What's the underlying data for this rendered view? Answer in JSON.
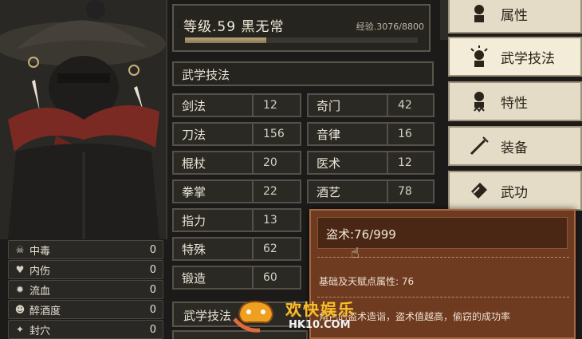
{
  "character": {
    "level_title": "等级.59 黑无常",
    "exp_text": "经验.3076/8800",
    "exp_progress": 0.35
  },
  "section": {
    "title": "武学技法"
  },
  "stats": [
    {
      "name": "剑法",
      "value": "12"
    },
    {
      "name": "奇门",
      "value": "42"
    },
    {
      "name": "刀法",
      "value": "156"
    },
    {
      "name": "音律",
      "value": "16"
    },
    {
      "name": "棍杖",
      "value": "20"
    },
    {
      "name": "医术",
      "value": "12"
    },
    {
      "name": "拳掌",
      "value": "22"
    },
    {
      "name": "酒艺",
      "value": "78"
    },
    {
      "name": "指力",
      "value": "13"
    },
    {
      "name": "特殊",
      "value": "62"
    },
    {
      "name": "锻造",
      "value": "60"
    }
  ],
  "bottom_button": "武学技法",
  "status_effects": [
    {
      "icon": "skull-icon",
      "label": "中毒",
      "value": "0"
    },
    {
      "icon": "broken-heart-icon",
      "label": "内伤",
      "value": "0"
    },
    {
      "icon": "blood-drop-icon",
      "label": "流血",
      "value": "0"
    },
    {
      "icon": "drunk-face-icon",
      "label": "醉酒度",
      "value": "0"
    },
    {
      "icon": "acupoint-icon",
      "label": "封穴",
      "value": "0"
    }
  ],
  "tabs": [
    {
      "icon": "person-icon",
      "label": "属性",
      "active": false
    },
    {
      "icon": "person-sparkle-icon",
      "label": "武学技法",
      "active": true
    },
    {
      "icon": "person-trait-icon",
      "label": "特性",
      "active": false
    },
    {
      "icon": "sword-icon",
      "label": "装备",
      "active": false
    },
    {
      "icon": "book-icon",
      "label": "武功",
      "active": false
    }
  ],
  "tooltip": {
    "title": "盗术:76/999",
    "base": "基础及天赋点属性: 76",
    "desc": "角色的盗术造诣，盗术值越高，偷窃的成功率"
  },
  "watermark": {
    "text": "欢快娱乐",
    "url": "HK10.COM"
  },
  "colors": {
    "tooltip_bg": "#6e3b20",
    "tab_bg": "#e4dcc6",
    "panel_bg": "#26241f"
  }
}
